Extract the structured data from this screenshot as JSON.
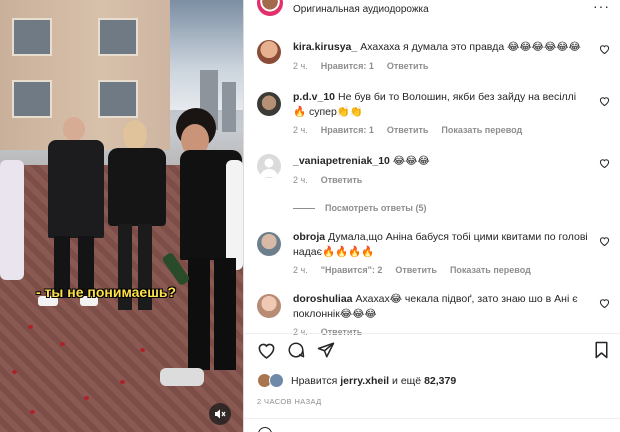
{
  "video": {
    "caption": "- ты не понимаешь?",
    "mute_icon": "speaker-muted-icon"
  },
  "header": {
    "subtitle": "Оригинальная аудиодорожка",
    "more_icon": "more-horizontal-icon",
    "more_glyph": "···"
  },
  "comments": [
    {
      "username": "kira.kirusya_",
      "text": "Ахахаха я думала это правда 😂😂😂😂😂😂",
      "time": "2 ч.",
      "likes": "Нравится: 1",
      "reply": "Ответить",
      "avatar_color": "#c98a6a"
    },
    {
      "username": "p.d.v_10",
      "text": "Не був би то Волошин, якби без зайду на весіллі🔥 супер👏👏",
      "time": "2 ч.",
      "likes": "Нравится: 1",
      "reply": "Ответить",
      "translate": "Показать перевод",
      "avatar_color": "#7a6a5a"
    },
    {
      "username": "_vaniapetreniak_10",
      "text": "😂😂😂",
      "time": "2 ч.",
      "reply": "Ответить",
      "avatar_color": "#d8d8d8"
    },
    {
      "username": "obroja",
      "text": "Думала,що Аніна бабуся тобі цими квитами по голові надає🔥🔥🔥🔥",
      "time": "2 ч.",
      "likes": "\"Нравится\": 2",
      "reply": "Ответить",
      "translate": "Показать перевод",
      "avatar_color": "#9aa8b5"
    },
    {
      "username": "doroshuliaa",
      "text": "Ахахах😂 чекала підвоґ, зато знаю шо в Ані є поклоннік😂😂😂",
      "time": "2 ч.",
      "reply": "Ответить",
      "avatar_color": "#d9b8a6"
    }
  ],
  "view_replies": "Посмотреть ответы (5)",
  "actions": {
    "like_icon": "heart-icon",
    "comment_icon": "comment-icon",
    "share_icon": "share-icon",
    "save_icon": "bookmark-icon"
  },
  "likes_line": {
    "prefix": "Нравится",
    "user": "jerry.xheil",
    "middle": "и ещё",
    "count": "82,379"
  },
  "timestamp": "2 ЧАСОВ НАЗАД",
  "colors": {
    "text": "#262626",
    "muted": "#8e8e8e",
    "caption": "#ffe24a"
  }
}
